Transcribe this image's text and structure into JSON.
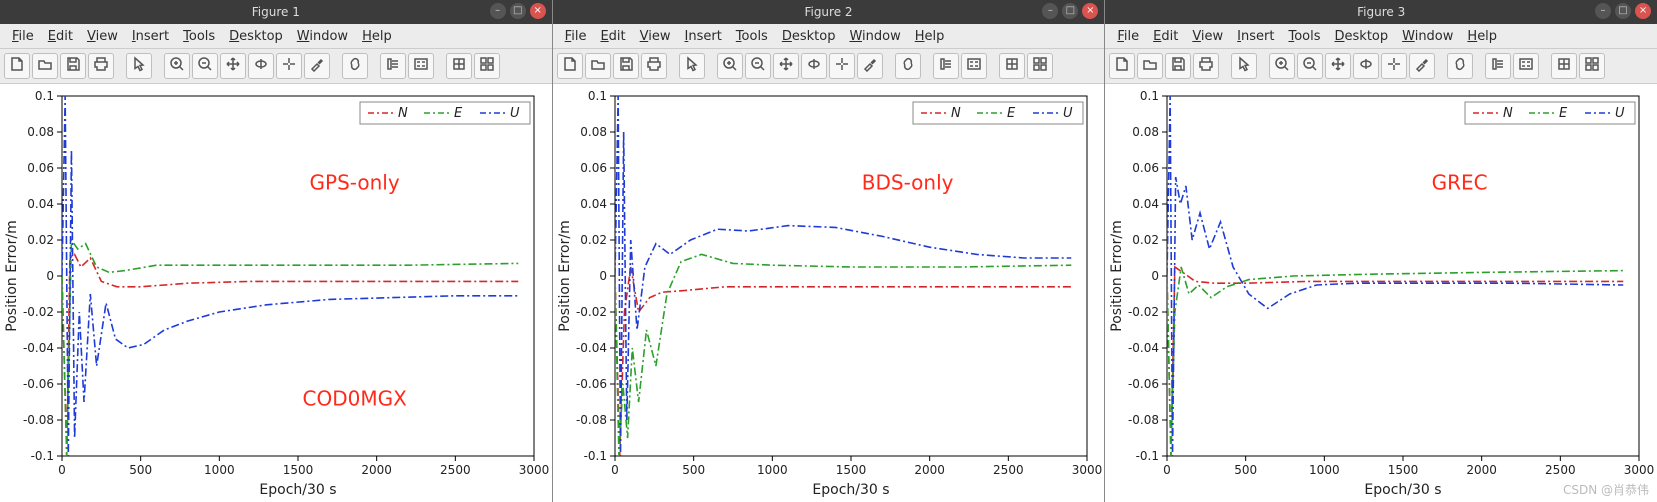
{
  "windows": [
    {
      "title": "Figure 1"
    },
    {
      "title": "Figure 2"
    },
    {
      "title": "Figure 3"
    }
  ],
  "window_controls": {
    "min": "–",
    "max": "□",
    "close": "×"
  },
  "menus": [
    "File",
    "Edit",
    "View",
    "Insert",
    "Tools",
    "Desktop",
    "Window",
    "Help"
  ],
  "toolbar_icons": [
    "new",
    "open",
    "save",
    "print",
    "|",
    "pointer",
    "|",
    "zoom-in",
    "zoom-out",
    "pan",
    "rotate3d",
    "data-cursor",
    "brush",
    "|",
    "link",
    "|",
    "colorbar",
    "legend",
    "|",
    "grid",
    "subplot"
  ],
  "legend": {
    "items": [
      {
        "name": "N",
        "color": "#d62728"
      },
      {
        "name": "E",
        "color": "#2ca02c"
      },
      {
        "name": "U",
        "color": "#1f3bd6"
      }
    ]
  },
  "axes": {
    "xlabel": "Epoch/30 s",
    "ylabel": "Position Error/m",
    "xticks": [
      0,
      500,
      1000,
      1500,
      2000,
      2500,
      3000
    ],
    "yticks": [
      -0.1,
      -0.08,
      -0.06,
      -0.04,
      -0.02,
      0,
      0.02,
      0.04,
      0.06,
      0.08,
      0.1
    ],
    "xlim": [
      0,
      3000
    ],
    "ylim": [
      -0.1,
      0.1
    ]
  },
  "annotations": [
    [
      "GPS-only",
      "COD0MGX"
    ],
    [
      "BDS-only"
    ],
    [
      "GREC"
    ]
  ],
  "watermark": "CSDN @肖恭伟",
  "chart_data": [
    {
      "type": "line",
      "title": "GPS-only / COD0MGX",
      "xlabel": "Epoch/30 s",
      "ylabel": "Position Error/m",
      "xlim": [
        0,
        3000
      ],
      "ylim": [
        -0.1,
        0.1
      ],
      "series": [
        {
          "name": "N",
          "color": "#d62728",
          "style": "dashdot",
          "points": [
            [
              0,
              0
            ],
            [
              30,
              -0.1
            ],
            [
              50,
              0.01
            ],
            [
              80,
              0.012
            ],
            [
              120,
              0.005
            ],
            [
              180,
              0.01
            ],
            [
              250,
              -0.003
            ],
            [
              350,
              -0.006
            ],
            [
              500,
              -0.006
            ],
            [
              800,
              -0.004
            ],
            [
              1200,
              -0.003
            ],
            [
              1800,
              -0.003
            ],
            [
              2500,
              -0.003
            ],
            [
              2900,
              -0.003
            ]
          ]
        },
        {
          "name": "E",
          "color": "#2ca02c",
          "style": "dashdot",
          "points": [
            [
              0,
              0
            ],
            [
              30,
              -0.1
            ],
            [
              60,
              0.02
            ],
            [
              100,
              0.015
            ],
            [
              150,
              0.018
            ],
            [
              220,
              0.005
            ],
            [
              300,
              0.002
            ],
            [
              400,
              0.003
            ],
            [
              600,
              0.006
            ],
            [
              1000,
              0.006
            ],
            [
              1600,
              0.006
            ],
            [
              2200,
              0.006
            ],
            [
              2900,
              0.007
            ]
          ]
        },
        {
          "name": "U",
          "color": "#1f3bd6",
          "style": "dashdot",
          "points": [
            [
              0,
              0
            ],
            [
              20,
              0.1
            ],
            [
              40,
              -0.1
            ],
            [
              60,
              0.07
            ],
            [
              80,
              -0.09
            ],
            [
              110,
              -0.02
            ],
            [
              140,
              -0.07
            ],
            [
              180,
              -0.01
            ],
            [
              220,
              -0.05
            ],
            [
              280,
              -0.015
            ],
            [
              340,
              -0.035
            ],
            [
              420,
              -0.04
            ],
            [
              520,
              -0.038
            ],
            [
              650,
              -0.03
            ],
            [
              800,
              -0.025
            ],
            [
              1000,
              -0.02
            ],
            [
              1300,
              -0.016
            ],
            [
              1700,
              -0.013
            ],
            [
              2100,
              -0.012
            ],
            [
              2500,
              -0.011
            ],
            [
              2900,
              -0.011
            ]
          ]
        }
      ]
    },
    {
      "type": "line",
      "title": "BDS-only",
      "xlabel": "Epoch/30 s",
      "ylabel": "Position Error/m",
      "xlim": [
        0,
        3000
      ],
      "ylim": [
        -0.1,
        0.1
      ],
      "series": [
        {
          "name": "N",
          "color": "#d62728",
          "style": "dashdot",
          "points": [
            [
              0,
              0
            ],
            [
              30,
              -0.1
            ],
            [
              60,
              -0.02
            ],
            [
              100,
              0.005
            ],
            [
              150,
              -0.02
            ],
            [
              220,
              -0.012
            ],
            [
              300,
              -0.009
            ],
            [
              450,
              -0.008
            ],
            [
              700,
              -0.006
            ],
            [
              1100,
              -0.006
            ],
            [
              1700,
              -0.006
            ],
            [
              2400,
              -0.006
            ],
            [
              2900,
              -0.006
            ]
          ]
        },
        {
          "name": "E",
          "color": "#2ca02c",
          "style": "dashdot",
          "points": [
            [
              0,
              0
            ],
            [
              25,
              -0.1
            ],
            [
              50,
              -0.06
            ],
            [
              80,
              -0.09
            ],
            [
              110,
              -0.04
            ],
            [
              150,
              -0.07
            ],
            [
              200,
              -0.03
            ],
            [
              260,
              -0.05
            ],
            [
              330,
              -0.01
            ],
            [
              420,
              0.008
            ],
            [
              550,
              0.012
            ],
            [
              750,
              0.007
            ],
            [
              1000,
              0.006
            ],
            [
              1500,
              0.005
            ],
            [
              2200,
              0.005
            ],
            [
              2900,
              0.006
            ]
          ]
        },
        {
          "name": "U",
          "color": "#1f3bd6",
          "style": "dashdot",
          "points": [
            [
              0,
              0
            ],
            [
              20,
              0.1
            ],
            [
              35,
              -0.1
            ],
            [
              55,
              0.08
            ],
            [
              75,
              -0.08
            ],
            [
              100,
              0.02
            ],
            [
              140,
              -0.03
            ],
            [
              190,
              0.005
            ],
            [
              260,
              0.018
            ],
            [
              350,
              0.012
            ],
            [
              480,
              0.02
            ],
            [
              650,
              0.026
            ],
            [
              850,
              0.025
            ],
            [
              1100,
              0.028
            ],
            [
              1400,
              0.027
            ],
            [
              1700,
              0.022
            ],
            [
              2000,
              0.016
            ],
            [
              2300,
              0.012
            ],
            [
              2600,
              0.01
            ],
            [
              2900,
              0.01
            ]
          ]
        }
      ]
    },
    {
      "type": "line",
      "title": "GREC",
      "xlabel": "Epoch/30 s",
      "ylabel": "Position Error/m",
      "xlim": [
        0,
        3000
      ],
      "ylim": [
        -0.1,
        0.1
      ],
      "series": [
        {
          "name": "N",
          "color": "#d62728",
          "style": "dashdot",
          "points": [
            [
              0,
              0
            ],
            [
              25,
              -0.1
            ],
            [
              50,
              0.005
            ],
            [
              100,
              0.002
            ],
            [
              180,
              -0.003
            ],
            [
              300,
              -0.004
            ],
            [
              500,
              -0.004
            ],
            [
              900,
              -0.003
            ],
            [
              1500,
              -0.003
            ],
            [
              2200,
              -0.003
            ],
            [
              2900,
              -0.003
            ]
          ]
        },
        {
          "name": "E",
          "color": "#2ca02c",
          "style": "dashdot",
          "points": [
            [
              0,
              0
            ],
            [
              25,
              -0.1
            ],
            [
              50,
              -0.02
            ],
            [
              90,
              0.005
            ],
            [
              140,
              -0.01
            ],
            [
              200,
              -0.005
            ],
            [
              280,
              -0.012
            ],
            [
              380,
              -0.006
            ],
            [
              520,
              -0.002
            ],
            [
              800,
              0.0
            ],
            [
              1300,
              0.001
            ],
            [
              2000,
              0.002
            ],
            [
              2900,
              0.003
            ]
          ]
        },
        {
          "name": "U",
          "color": "#1f3bd6",
          "style": "dashdot",
          "points": [
            [
              0,
              0
            ],
            [
              20,
              0.1
            ],
            [
              35,
              -0.1
            ],
            [
              55,
              0.055
            ],
            [
              85,
              0.04
            ],
            [
              120,
              0.05
            ],
            [
              160,
              0.02
            ],
            [
              210,
              0.035
            ],
            [
              270,
              0.015
            ],
            [
              340,
              0.03
            ],
            [
              420,
              0.005
            ],
            [
              520,
              -0.01
            ],
            [
              640,
              -0.018
            ],
            [
              780,
              -0.01
            ],
            [
              950,
              -0.005
            ],
            [
              1200,
              -0.004
            ],
            [
              1600,
              -0.004
            ],
            [
              2200,
              -0.004
            ],
            [
              2900,
              -0.005
            ]
          ]
        }
      ]
    }
  ]
}
